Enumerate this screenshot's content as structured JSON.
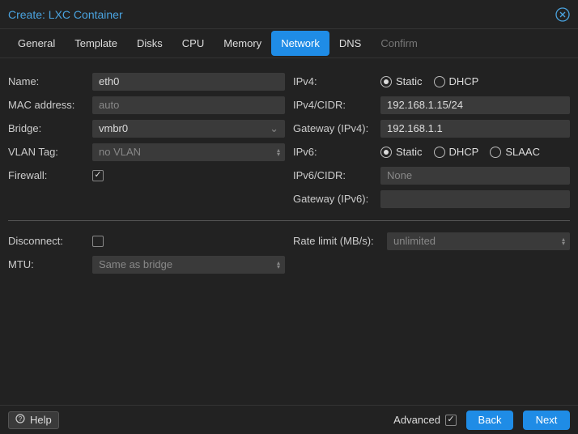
{
  "window": {
    "title": "Create: LXC Container"
  },
  "tabs": [
    {
      "label": "General"
    },
    {
      "label": "Template"
    },
    {
      "label": "Disks"
    },
    {
      "label": "CPU"
    },
    {
      "label": "Memory"
    },
    {
      "label": "Network",
      "active": true
    },
    {
      "label": "DNS"
    },
    {
      "label": "Confirm",
      "disabled": true
    }
  ],
  "form": {
    "left": {
      "name_label": "Name:",
      "name_value": "eth0",
      "mac_label": "MAC address:",
      "mac_placeholder": "auto",
      "bridge_label": "Bridge:",
      "bridge_value": "vmbr0",
      "vlan_label": "VLAN Tag:",
      "vlan_placeholder": "no VLAN",
      "firewall_label": "Firewall:",
      "firewall_checked": true,
      "disconnect_label": "Disconnect:",
      "disconnect_checked": false,
      "mtu_label": "MTU:",
      "mtu_placeholder": "Same as bridge"
    },
    "right": {
      "ipv4_label": "IPv4:",
      "ipv4_mode": "Static",
      "ipv4_options": [
        "Static",
        "DHCP"
      ],
      "ipv4cidr_label": "IPv4/CIDR:",
      "ipv4cidr_value": "192.168.1.15/24",
      "gw4_label": "Gateway (IPv4):",
      "gw4_value": "192.168.1.1",
      "ipv6_label": "IPv6:",
      "ipv6_mode": "Static",
      "ipv6_options": [
        "Static",
        "DHCP",
        "SLAAC"
      ],
      "ipv6cidr_label": "IPv6/CIDR:",
      "ipv6cidr_placeholder": "None",
      "gw6_label": "Gateway (IPv6):",
      "gw6_value": "",
      "ratelimit_label": "Rate limit (MB/s):",
      "ratelimit_placeholder": "unlimited"
    }
  },
  "footer": {
    "help_label": "Help",
    "advanced_label": "Advanced",
    "advanced_checked": true,
    "back_label": "Back",
    "next_label": "Next"
  }
}
